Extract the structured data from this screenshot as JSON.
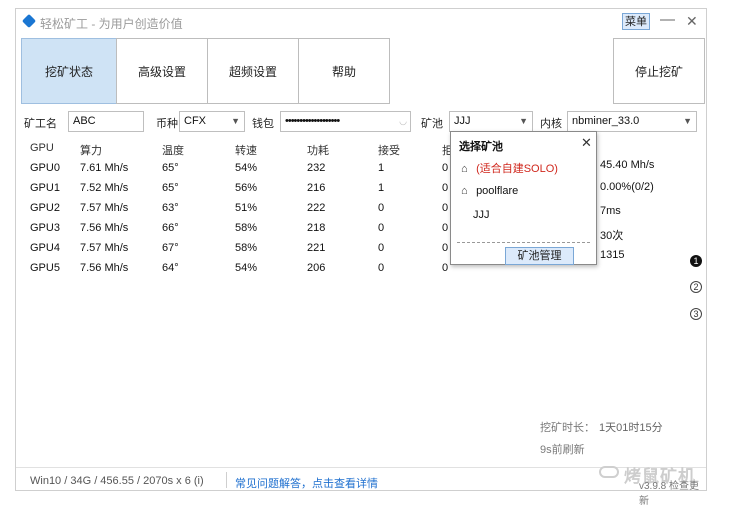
{
  "window": {
    "title": "轻松矿工 - 为用户创造价值",
    "menu_label": "菜单",
    "minimize_glyph": "—",
    "close_glyph": "✕"
  },
  "tabs": [
    {
      "label": "挖矿状态",
      "active": true
    },
    {
      "label": "高级设置",
      "active": false
    },
    {
      "label": "超频设置",
      "active": false
    },
    {
      "label": "帮助",
      "active": false
    }
  ],
  "stop_button": "停止挖矿",
  "toolbar": {
    "miner_name_label": "矿工名",
    "miner_name_value": "ABC",
    "coin_label": "币种",
    "coin_value": "CFX",
    "wallet_label": "钱包",
    "wallet_value": "•••••••••••••••••••",
    "pool_label": "矿池",
    "pool_value": "JJJ",
    "kernel_label": "内核",
    "kernel_value": "nbminer_33.0"
  },
  "gpu_table": {
    "headers": [
      "GPU",
      "算力",
      "温度",
      "转速",
      "功耗",
      "接受",
      "拒"
    ],
    "rows": [
      [
        "GPU0",
        "7.61 Mh/s",
        "65°",
        "54%",
        "232",
        "1",
        "0"
      ],
      [
        "GPU1",
        "7.52 Mh/s",
        "65°",
        "56%",
        "216",
        "1",
        "0"
      ],
      [
        "GPU2",
        "7.57 Mh/s",
        "63°",
        "51%",
        "222",
        "0",
        "0"
      ],
      [
        "GPU3",
        "7.56 Mh/s",
        "66°",
        "58%",
        "218",
        "0",
        "0"
      ],
      [
        "GPU4",
        "7.57 Mh/s",
        "67°",
        "58%",
        "221",
        "0",
        "0"
      ],
      [
        "GPU5",
        "7.56 Mh/s",
        "64°",
        "54%",
        "206",
        "0",
        "0"
      ]
    ]
  },
  "stats": {
    "total_hashrate": "45.40 Mh/s",
    "reject_rate": "0.00%(0/2)",
    "latency": "7ms",
    "count": "30次",
    "value": "1315"
  },
  "side_buttons": [
    "❶",
    "②",
    "③"
  ],
  "mining_time_label": "挖矿时长：",
  "mining_time_value": "1天01时15分",
  "refresh_text": "9s前刷新",
  "status": {
    "system_info": "Win10  / 34G / 456.55 / 2070s x 6 (i)",
    "faq_link": "常见问题解答，点击查看详情",
    "version": "v3.9.8 检查更新",
    "watermark": "烤鼠矿机"
  },
  "pool_popup": {
    "title": "选择矿池",
    "close_glyph": "✕",
    "items": [
      {
        "label": "(适合自建SOLO)",
        "icon": "home-icon",
        "highlight": true
      },
      {
        "label": "poolflare",
        "icon": "home-icon",
        "highlight": false
      },
      {
        "label": "JJJ",
        "icon": "",
        "highlight": false
      }
    ],
    "manage_button": "矿池管理"
  },
  "colors": {
    "accent": "#1a76d2",
    "active_tab": "#cfe3f5",
    "link": "#1e6fcf",
    "highlight_red": "#d0281e"
  }
}
